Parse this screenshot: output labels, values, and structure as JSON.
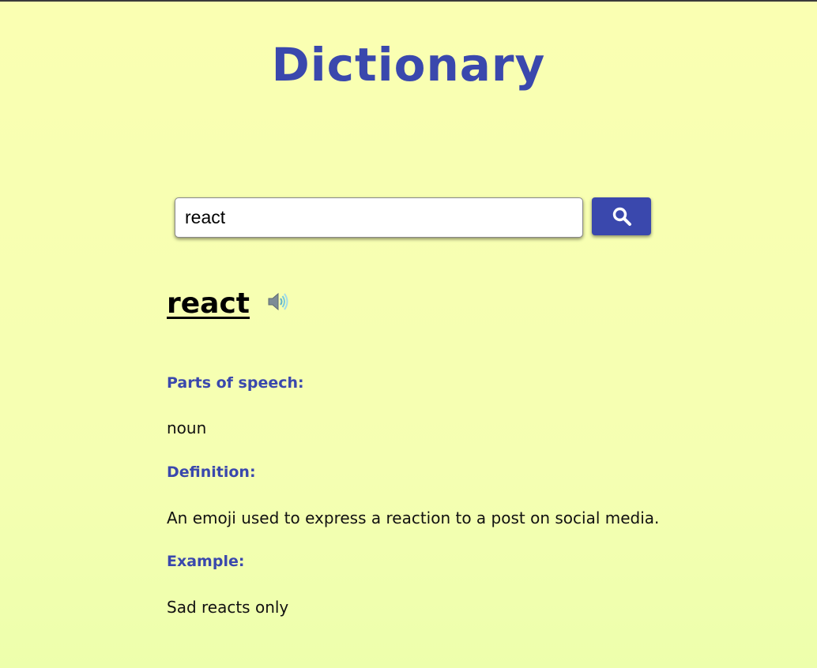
{
  "header": {
    "title": "Dictionary"
  },
  "search": {
    "value": "react",
    "button_icon": "search-icon"
  },
  "result": {
    "word": "react",
    "audio_icon": "speaker-icon",
    "parts_of_speech_label": "Parts of speech:",
    "parts_of_speech": "noun",
    "definition_label": "Definition:",
    "definition": "An emoji used to express a reaction to a post on social media.",
    "example_label": "Example:",
    "example": "Sad reacts only"
  },
  "colors": {
    "accent": "#3a48ad",
    "background": "#f7ffb2",
    "text": "#111111"
  }
}
